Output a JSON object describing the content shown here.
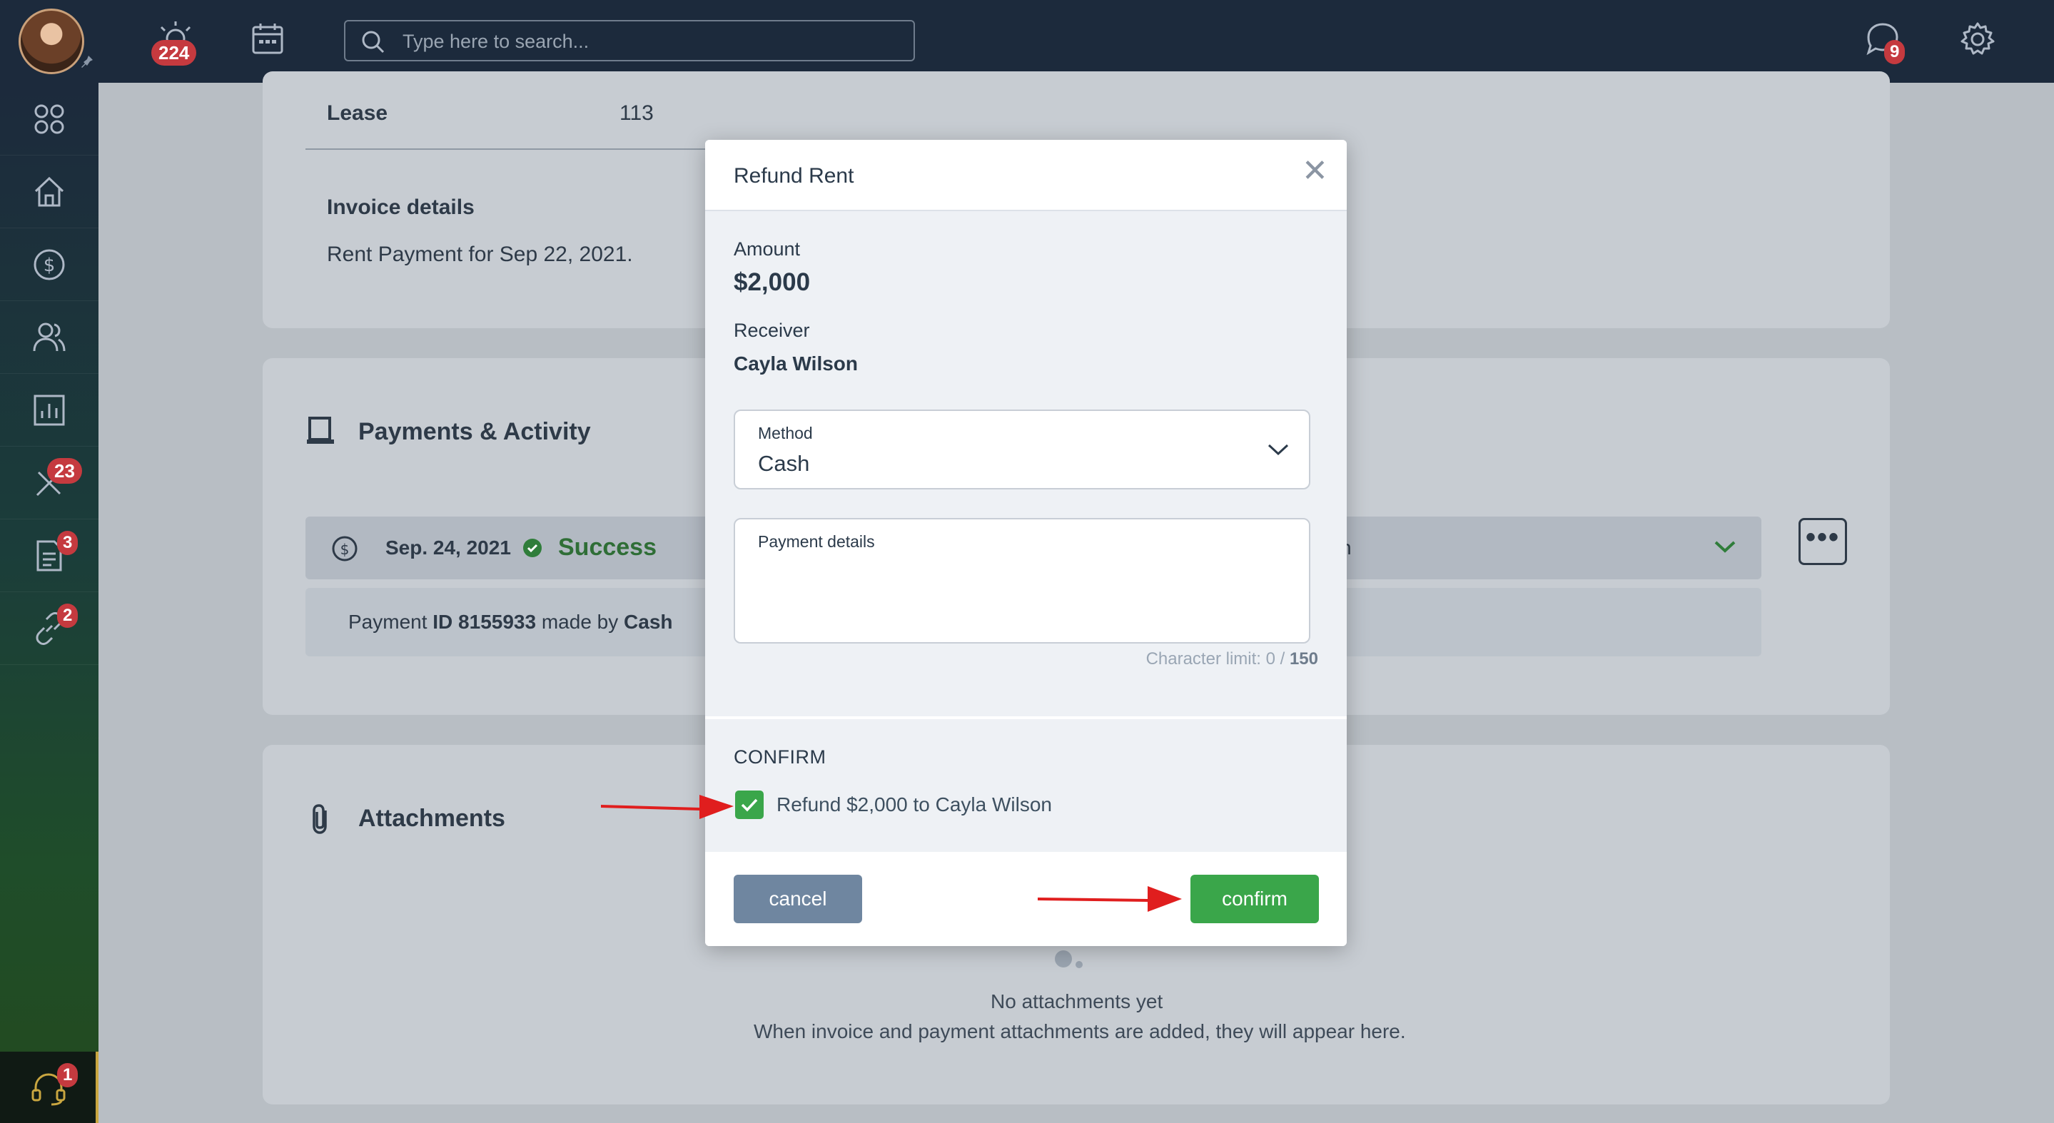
{
  "topbar": {
    "notifications_count": "224",
    "search_placeholder": "Type here to search...",
    "messages_count": "9"
  },
  "sidebar": {
    "badges": {
      "maintenance": "23",
      "tasks": "3",
      "links": "2",
      "support": "1"
    }
  },
  "background": {
    "lease_label": "Lease",
    "lease_value": "113",
    "invoice_details_label": "Invoice details",
    "invoice_details_text": "Rent Payment for Sep 22, 2021.",
    "payments_title": "Payments & Activity",
    "payment_date": "Sep. 24, 2021",
    "payment_status": "Success",
    "payment_line_prefix": "Payment",
    "payment_id": "ID 8155933",
    "payment_made_by": "made by",
    "payment_method": "Cash",
    "attachments_title": "Attachments",
    "no_attachments": "No attachments yet",
    "no_attachments_hint": "When invoice and payment attachments are added, they will appear here.",
    "truncated_fragment": "n"
  },
  "modal": {
    "title": "Refund Rent",
    "amount_label": "Amount",
    "amount_value": "$2,000",
    "receiver_label": "Receiver",
    "receiver_value": "Cayla Wilson",
    "method_label": "Method",
    "method_value": "Cash",
    "payment_details_label": "Payment details",
    "char_limit_prefix": "Character limit: 0 / ",
    "char_limit_max": "150",
    "confirm_heading": "CONFIRM",
    "confirm_checkbox_label": "Refund $2,000 to Cayla Wilson",
    "cancel_label": "cancel",
    "confirm_label": "confirm"
  },
  "colors": {
    "topbar": "#1c2a3c",
    "success_green": "#3aa64a",
    "cancel_blue": "#6f86a0",
    "badge_red": "#c53a3f",
    "annotation_red": "#e01e1e"
  }
}
